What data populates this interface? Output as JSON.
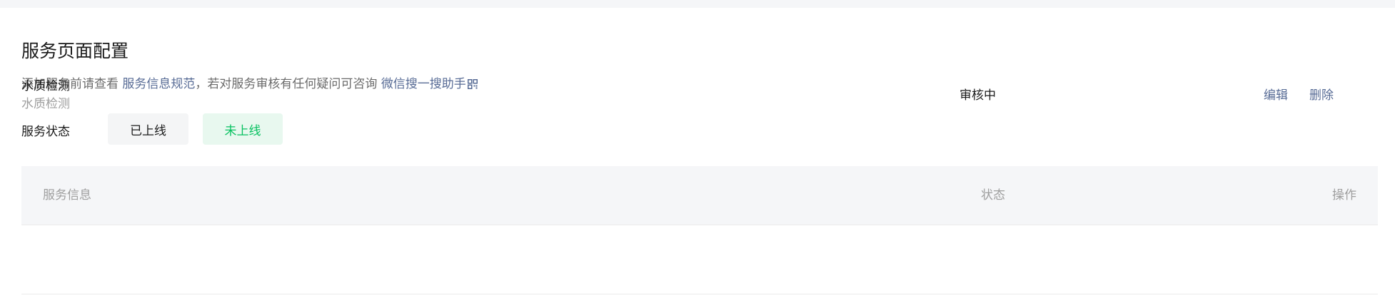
{
  "page": {
    "title": "服务页面配置",
    "desc_prefix": "添加服务前请查看",
    "desc_link1": "服务信息规范",
    "desc_middle": "，若对服务审核有任何疑问可咨询",
    "desc_link2": "微信搜一搜助手",
    "link_color": "#576b95",
    "accent_color": "#07c160"
  },
  "filter": {
    "label": "服务状态",
    "options": [
      "已上线",
      "未上线"
    ],
    "selected": "未上线"
  },
  "table": {
    "columns": [
      "服务信息",
      "状态",
      "操作"
    ],
    "rows": [
      {
        "name": "水质检测",
        "subtitle": "水质检测",
        "status": "审核中",
        "actions": [
          "编辑",
          "删除"
        ]
      }
    ]
  },
  "icons": {
    "qr": "qrcode-icon"
  }
}
